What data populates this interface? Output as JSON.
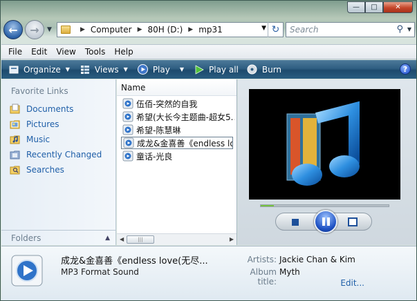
{
  "window": {
    "controls": {
      "minimize": "—",
      "maximize": "□",
      "close": "✕"
    }
  },
  "address_bar": {
    "crumbs": [
      "Computer",
      "80H (D:)",
      "mp31"
    ],
    "search_placeholder": "Search"
  },
  "menu": [
    "File",
    "Edit",
    "View",
    "Tools",
    "Help"
  ],
  "toolbar": {
    "organize": "Organize",
    "views": "Views",
    "play": "Play",
    "play_all": "Play all",
    "burn": "Burn",
    "help": "?"
  },
  "nav_pane": {
    "heading": "Favorite Links",
    "links": [
      {
        "label": "Documents",
        "icon": "documents-icon"
      },
      {
        "label": "Pictures",
        "icon": "pictures-icon"
      },
      {
        "label": "Music",
        "icon": "music-icon"
      },
      {
        "label": "Recently Changed",
        "icon": "recently-changed-icon"
      },
      {
        "label": "Searches",
        "icon": "searches-icon"
      }
    ],
    "folders_label": "Folders"
  },
  "file_list": {
    "column_header": "Name",
    "files": [
      "伍佰-突然的自我",
      "希望(大长今主题曲-超女5...",
      "希望-陈慧琳",
      "成龙&金喜善《endless lov...",
      "童话-光良"
    ],
    "selected_index": 3
  },
  "player": {
    "progress_fraction": 0.1,
    "state": "playing"
  },
  "details": {
    "title": "成龙&金喜善《endless love(无尽...",
    "type": "MP3 Format Sound",
    "artists_label": "Artists:",
    "artists_value": "Jackie Chan & Kim",
    "album_label": "Album title:",
    "album_value": "Myth",
    "edit_link": "Edit..."
  },
  "colors": {
    "command_bar": "#2f5e82",
    "link": "#1f5fa8",
    "nav_pane_bg": "#e6eef6"
  }
}
